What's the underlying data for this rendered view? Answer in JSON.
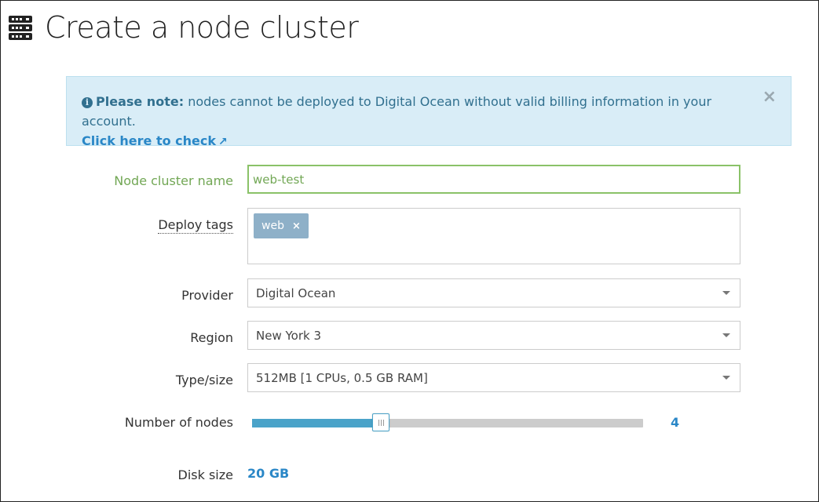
{
  "header": {
    "title": "Create a node cluster",
    "icon": "server-icon"
  },
  "alert": {
    "icon": "info-icon",
    "strong": "Please note:",
    "message": "nodes cannot be deployed to Digital Ocean without valid billing information in your account.",
    "link_label": "Click here to check",
    "link_icon": "external-link-icon",
    "close_label": "×",
    "colors": {
      "background": "#d9edf7",
      "text": "#31708f",
      "link": "#2a87c7"
    }
  },
  "form": {
    "name": {
      "label": "Node cluster name",
      "value": "web-test",
      "state_color": "#72a755"
    },
    "tags": {
      "label": "Deploy tags",
      "items": [
        {
          "label": "web",
          "remove": "×"
        }
      ]
    },
    "provider": {
      "label": "Provider",
      "selected": "Digital Ocean"
    },
    "region": {
      "label": "Region",
      "selected": "New York 3"
    },
    "type_size": {
      "label": "Type/size",
      "selected": "512MB [1 CPUs, 0.5 GB RAM]"
    },
    "nodes": {
      "label": "Number of nodes",
      "value": "4",
      "fraction": 0.33,
      "accent": "#4aa3c9"
    },
    "disk": {
      "label": "Disk size",
      "value": "20 GB"
    }
  }
}
